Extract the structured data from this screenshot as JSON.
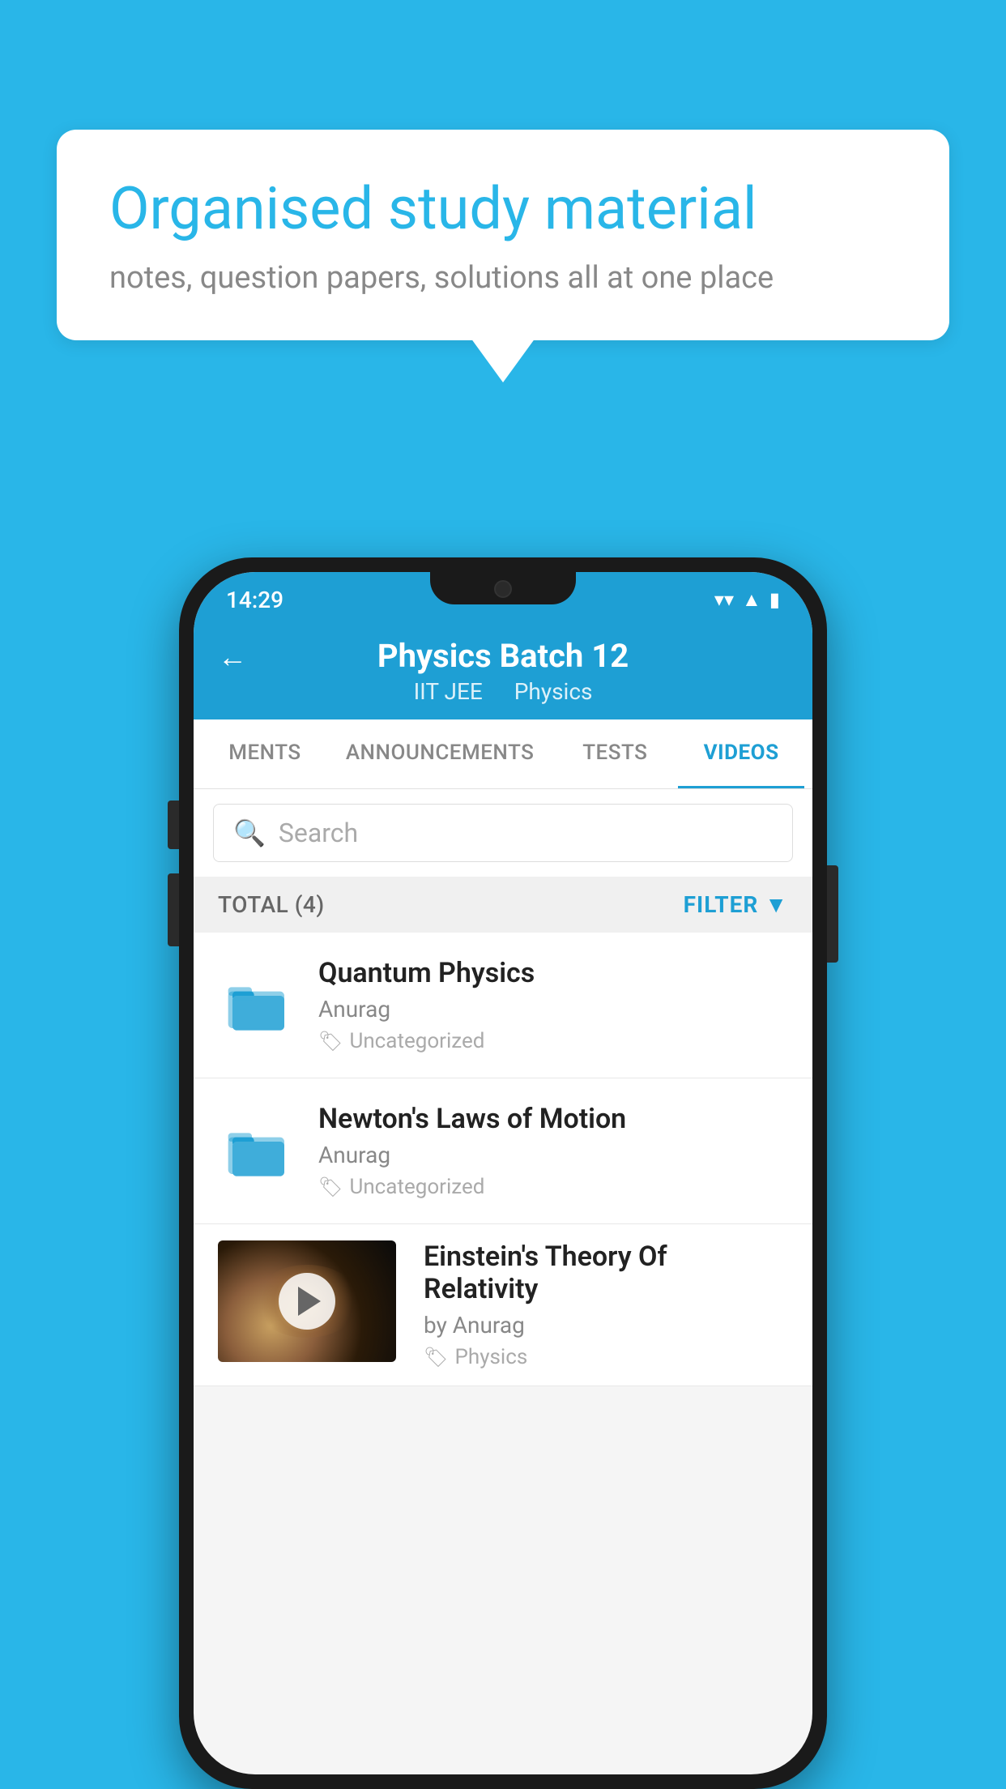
{
  "background_color": "#29b6e8",
  "speech_bubble": {
    "title": "Organised study material",
    "subtitle": "notes, question papers, solutions all at one place"
  },
  "phone": {
    "status_bar": {
      "time": "14:29"
    },
    "header": {
      "back_label": "←",
      "title": "Physics Batch 12",
      "subtitle_left": "IIT JEE",
      "subtitle_right": "Physics"
    },
    "tabs": [
      {
        "label": "MENTS",
        "active": false
      },
      {
        "label": "ANNOUNCEMENTS",
        "active": false
      },
      {
        "label": "TESTS",
        "active": false
      },
      {
        "label": "VIDEOS",
        "active": true
      }
    ],
    "search": {
      "placeholder": "Search"
    },
    "filter_bar": {
      "total_label": "TOTAL (4)",
      "filter_label": "FILTER"
    },
    "videos": [
      {
        "title": "Quantum Physics",
        "author": "Anurag",
        "tag": "Uncategorized",
        "has_thumb": false
      },
      {
        "title": "Newton's Laws of Motion",
        "author": "Anurag",
        "tag": "Uncategorized",
        "has_thumb": false
      },
      {
        "title": "Einstein's Theory Of Relativity",
        "author": "by Anurag",
        "tag": "Physics",
        "has_thumb": true
      }
    ]
  }
}
